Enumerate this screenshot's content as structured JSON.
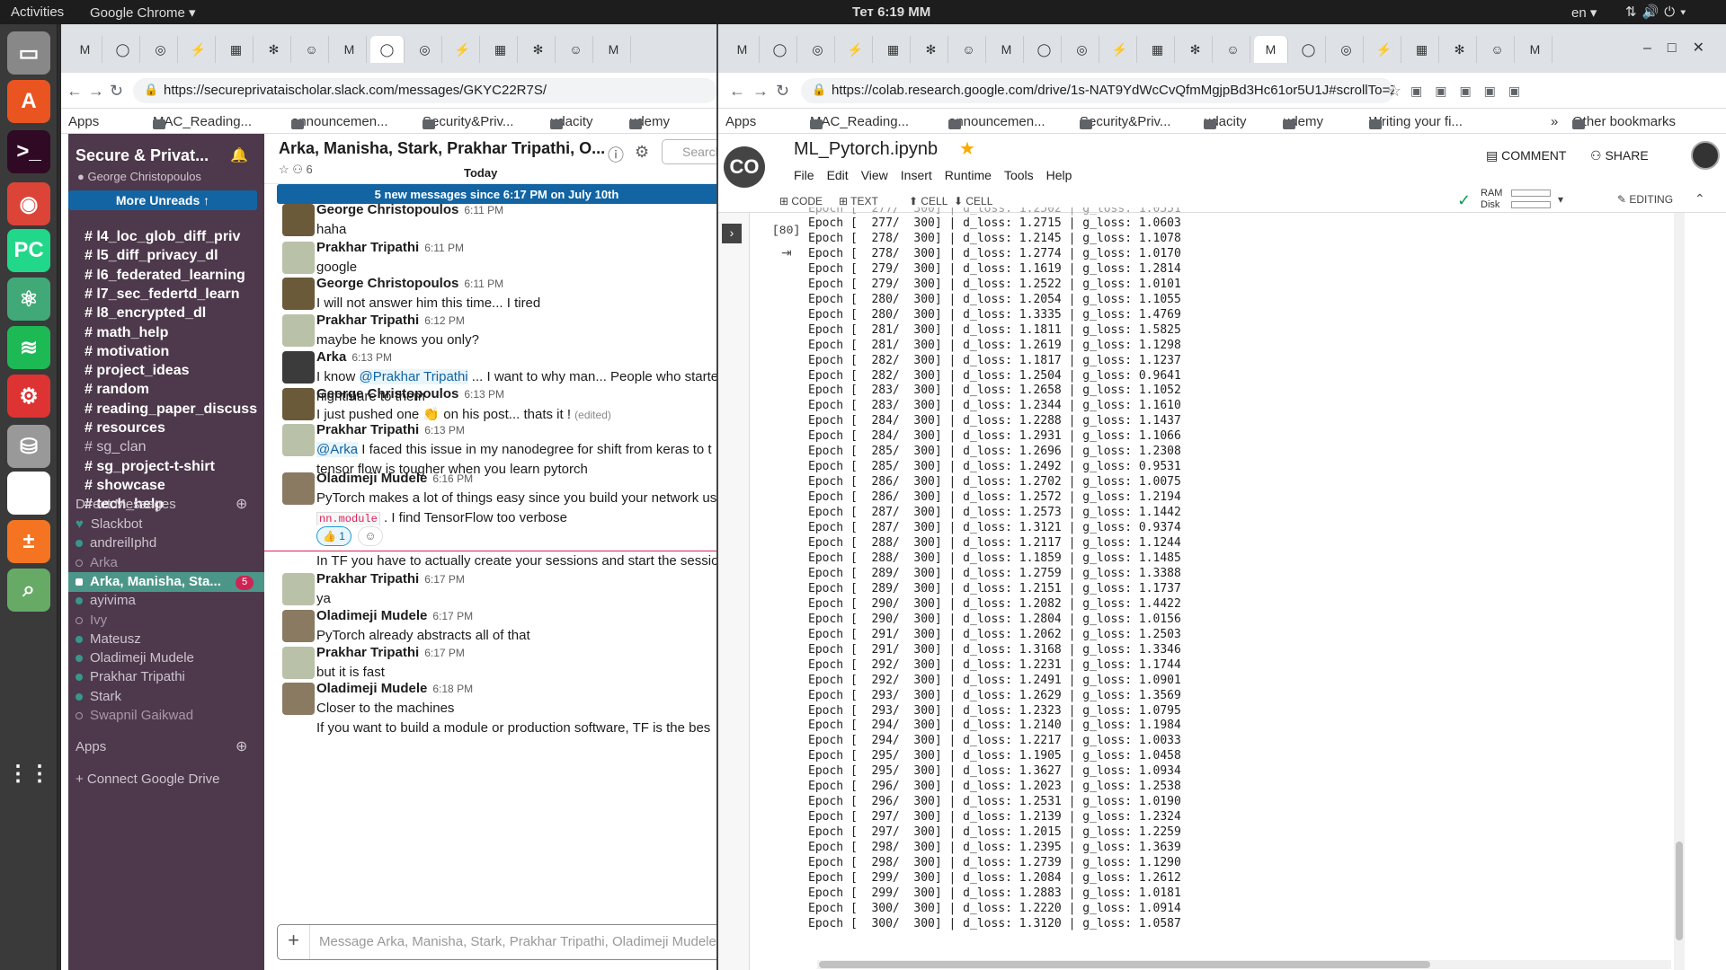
{
  "system": {
    "activities": "Activities",
    "app": "Google Chrome ▾",
    "clock": "Тет 6:19 MM",
    "lang": "en ▾"
  },
  "dock": [
    {
      "name": "files-icon",
      "glyph": "▭",
      "color": "#888"
    },
    {
      "name": "software-icon",
      "glyph": "A",
      "color": "#e95420"
    },
    {
      "name": "terminal-icon",
      "glyph": ">_",
      "color": "#300a24"
    },
    {
      "name": "chrome-icon",
      "glyph": "◉",
      "color": "#db4437"
    },
    {
      "name": "pycharm-icon",
      "glyph": "PC",
      "color": "#21d789"
    },
    {
      "name": "atom-icon",
      "glyph": "⚛",
      "color": "#40a977"
    },
    {
      "name": "spotify-icon",
      "glyph": "≋",
      "color": "#1db954"
    },
    {
      "name": "settings-icon",
      "glyph": "⚙",
      "color": "#d33"
    },
    {
      "name": "disk-icon",
      "glyph": "⛁",
      "color": "#999"
    },
    {
      "name": "editor-icon",
      "glyph": "✎",
      "color": "#fff"
    },
    {
      "name": "calculator-icon",
      "glyph": "±",
      "color": "#f47421"
    },
    {
      "name": "viewer-icon",
      "glyph": "⌕",
      "color": "#6a6"
    },
    {
      "name": "app-grid-icon",
      "glyph": "⋮⋮",
      "color": "#3a3a3a"
    }
  ],
  "slack_browser": {
    "url": "https://secureprivataischolar.slack.com/messages/GKYC22R7S/"
  },
  "colab_browser": {
    "url": "https://colab.research.google.com/drive/1s-NAT9YdWcCvQfmMgjpBd3Hc61or5U1J#scrollTo=Z070igUJbqRD"
  },
  "bookmarks_left": [
    "Apps",
    "MAC_Reading...",
    "announcemen...",
    "Security&Priv...",
    "udacity",
    "udemy"
  ],
  "bookmarks_right": [
    "Apps",
    "MAC_Reading...",
    "announcemen...",
    "Security&Priv...",
    "udacity",
    "udemy",
    "Writing your fi...",
    "»",
    "Other bookmarks"
  ],
  "slack": {
    "workspace": "Secure & Privat...",
    "user": "George Christopoulos",
    "more_unreads": "More Unreads  ↑",
    "channels": [
      {
        "label": "# l4_loc_glob_diff_priv",
        "bold": true
      },
      {
        "label": "# l5_diff_privacy_dl",
        "bold": true
      },
      {
        "label": "# l6_federated_learning",
        "bold": true
      },
      {
        "label": "# l7_sec_federtd_learn",
        "bold": true
      },
      {
        "label": "# l8_encrypted_dl",
        "bold": true
      },
      {
        "label": "# math_help",
        "bold": true
      },
      {
        "label": "# motivation",
        "bold": true
      },
      {
        "label": "# project_ideas",
        "bold": true
      },
      {
        "label": "# random",
        "bold": true
      },
      {
        "label": "# reading_paper_discuss",
        "bold": true
      },
      {
        "label": "# resources",
        "bold": true
      },
      {
        "label": "# sg_clan",
        "bold": false
      },
      {
        "label": "# sg_project-t-shirt",
        "bold": true
      },
      {
        "label": "# showcase",
        "bold": true
      },
      {
        "label": "# tech_help",
        "bold": true
      }
    ],
    "dm_header": "Direct Messages",
    "dms": [
      {
        "label": "Slackbot",
        "status": "heart"
      },
      {
        "label": "andreilIphd",
        "status": "online"
      },
      {
        "label": "Arka",
        "status": "away"
      },
      {
        "label": "Arka, Manisha, Sta...",
        "status": "group",
        "badge": "5"
      },
      {
        "label": "ayivima",
        "status": "online"
      },
      {
        "label": "Ivy",
        "status": "away"
      },
      {
        "label": "Mateusz",
        "status": "online"
      },
      {
        "label": "Oladimeji Mudele",
        "status": "online"
      },
      {
        "label": "Prakhar Tripathi",
        "status": "online"
      },
      {
        "label": "Stark",
        "status": "online"
      },
      {
        "label": "Swapnil Gaikwad",
        "status": "away"
      }
    ],
    "apps_header": "Apps",
    "connect_drive": "+ Connect Google Drive",
    "chat_title": "Arka, Manisha, Stark, Prakhar Tripathi, O...",
    "chat_sub": "☆  ⚇ 6",
    "search_placeholder": "Search",
    "today": "Today",
    "new_messages": "5 new messages since 6:17 PM on July 10th",
    "composer_placeholder": "Message Arka, Manisha, Stark, Prakhar Tripathi, Oladimeji Mudele",
    "messages": [
      {
        "name": "George Christopoulos",
        "time": "6:11 PM",
        "lines": [
          "haha"
        ]
      },
      {
        "name": "Prakhar Tripathi",
        "time": "6:11 PM",
        "lines": [
          "google"
        ]
      },
      {
        "name": "George Christopoulos",
        "time": "6:11 PM",
        "lines": [
          "I will not answer him this time... I tired"
        ]
      },
      {
        "name": "Prakhar Tripathi",
        "time": "6:12 PM",
        "lines": [
          "maybe he knows you only?"
        ]
      },
      {
        "name": "Arka",
        "time": "6:13 PM",
        "lines": [
          "I know @Prakhar Tripathi ... I want to why man... People who starte",
          "nightmare to them"
        ]
      },
      {
        "name": "George Christopoulos",
        "time": "6:13 PM",
        "lines": [
          "I just pushed one 👏 on his post... thats it ! (edited)"
        ]
      },
      {
        "name": "Prakhar Tripathi",
        "time": "6:13 PM",
        "lines": [
          "@Arka I faced this issue in my nanodegree for shift from keras to t",
          "tensor flow is tougher when you learn pytorch"
        ]
      },
      {
        "name": "Oladimeji Mudele",
        "time": "6:16 PM",
        "lines": [
          "PyTorch makes a lot of things easy since you build your network us",
          "nn.module . I find TensorFlow too verbose"
        ],
        "reaction": "👍 1"
      },
      {
        "name": "",
        "time": "",
        "lines": [
          "In TF you have to actually create your sessions and start the sessio"
        ]
      },
      {
        "name": "Prakhar Tripathi",
        "time": "6:17 PM",
        "lines": [
          "ya"
        ]
      },
      {
        "name": "Oladimeji Mudele",
        "time": "6:17 PM",
        "lines": [
          "PyTorch already abstracts all of that"
        ]
      },
      {
        "name": "Prakhar Tripathi",
        "time": "6:17 PM",
        "lines": [
          "but it is fast"
        ]
      },
      {
        "name": "Oladimeji Mudele",
        "time": "6:18 PM",
        "lines": [
          "Closer to the machines",
          "If you want to build a module or production software, TF is the bes"
        ]
      }
    ]
  },
  "colab": {
    "filename": "ML_Pytorch.ipynb",
    "menu": [
      "File",
      "Edit",
      "View",
      "Insert",
      "Runtime",
      "Tools",
      "Help"
    ],
    "comment": "COMMENT",
    "share": "SHARE",
    "toolbar": {
      "code": "CODE",
      "text": "TEXT",
      "cell_up": "CELL",
      "cell_down": "CELL",
      "ram": "RAM",
      "disk": "Disk",
      "editing": "EDITING"
    },
    "exec_count": "[80]",
    "output": [
      [
        "277",
        "1.2715",
        "1.0603"
      ],
      [
        "278",
        "1.2145",
        "1.1078"
      ],
      [
        "278",
        "1.2774",
        "1.0170"
      ],
      [
        "279",
        "1.1619",
        "1.2814"
      ],
      [
        "279",
        "1.2522",
        "1.0101"
      ],
      [
        "280",
        "1.2054",
        "1.1055"
      ],
      [
        "280",
        "1.3335",
        "1.4769"
      ],
      [
        "281",
        "1.1811",
        "1.5825"
      ],
      [
        "281",
        "1.2619",
        "1.1298"
      ],
      [
        "282",
        "1.1817",
        "1.1237"
      ],
      [
        "282",
        "1.2504",
        "0.9641"
      ],
      [
        "283",
        "1.2658",
        "1.1052"
      ],
      [
        "283",
        "1.2344",
        "1.1610"
      ],
      [
        "284",
        "1.2288",
        "1.1437"
      ],
      [
        "284",
        "1.2931",
        "1.1066"
      ],
      [
        "285",
        "1.2696",
        "1.2308"
      ],
      [
        "285",
        "1.2492",
        "0.9531"
      ],
      [
        "286",
        "1.2702",
        "1.0075"
      ],
      [
        "286",
        "1.2572",
        "1.2194"
      ],
      [
        "287",
        "1.2573",
        "1.1442"
      ],
      [
        "287",
        "1.3121",
        "0.9374"
      ],
      [
        "288",
        "1.2117",
        "1.1244"
      ],
      [
        "288",
        "1.1859",
        "1.1485"
      ],
      [
        "289",
        "1.2759",
        "1.3388"
      ],
      [
        "289",
        "1.2151",
        "1.1737"
      ],
      [
        "290",
        "1.2082",
        "1.4422"
      ],
      [
        "290",
        "1.2804",
        "1.0156"
      ],
      [
        "291",
        "1.2062",
        "1.2503"
      ],
      [
        "291",
        "1.3168",
        "1.3346"
      ],
      [
        "292",
        "1.2231",
        "1.1744"
      ],
      [
        "292",
        "1.2491",
        "1.0901"
      ],
      [
        "293",
        "1.2629",
        "1.3569"
      ],
      [
        "293",
        "1.2323",
        "1.0795"
      ],
      [
        "294",
        "1.2140",
        "1.1984"
      ],
      [
        "294",
        "1.2217",
        "1.0033"
      ],
      [
        "295",
        "1.1905",
        "1.0458"
      ],
      [
        "295",
        "1.3627",
        "1.0934"
      ],
      [
        "296",
        "1.2023",
        "1.2538"
      ],
      [
        "296",
        "1.2531",
        "1.0190"
      ],
      [
        "297",
        "1.2139",
        "1.2324"
      ],
      [
        "297",
        "1.2015",
        "1.2259"
      ],
      [
        "298",
        "1.2395",
        "1.3639"
      ],
      [
        "298",
        "1.2739",
        "1.1290"
      ],
      [
        "299",
        "1.2084",
        "1.2612"
      ],
      [
        "299",
        "1.2883",
        "1.0181"
      ],
      [
        "300",
        "1.2220",
        "1.0914"
      ],
      [
        "300",
        "1.3120",
        "1.0587"
      ]
    ],
    "total_epochs": "300"
  }
}
